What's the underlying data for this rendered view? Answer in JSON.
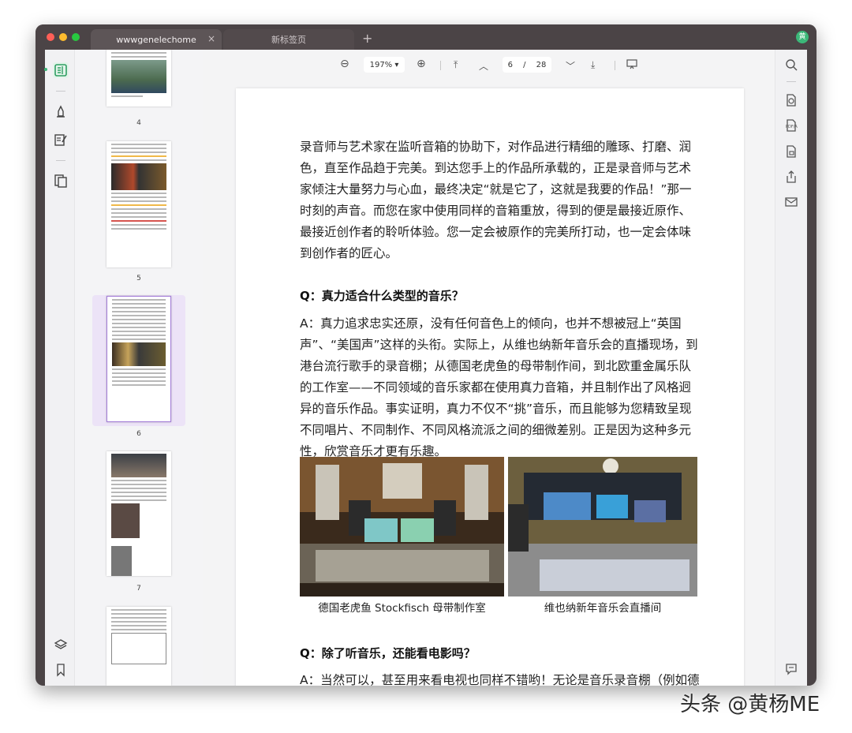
{
  "tabs": [
    {
      "label": "wwwgenelechome",
      "active": true
    },
    {
      "label": "新标签页",
      "active": false
    }
  ],
  "new_tab_glyph": "+",
  "tab_close_glyph": "×",
  "avatar_letter": "黄",
  "toolbar": {
    "zoom_out_glyph": "⊖",
    "zoom": "197%",
    "zoom_dropdown_glyph": "▾",
    "zoom_in_glyph": "⊕",
    "first_page_glyph": "⤒",
    "prev_page_glyph": "︿",
    "current_page": "6",
    "page_separator": "/",
    "total_pages": "28",
    "next_page_glyph": "﹀",
    "last_page_glyph": "⤓"
  },
  "thumbnails": [
    {
      "page_label": "4"
    },
    {
      "page_label": "5"
    },
    {
      "page_label": "6",
      "selected": true
    },
    {
      "page_label": "7"
    }
  ],
  "document": {
    "para1": "录音师与艺术家在监听音箱的协助下，对作品进行精细的雕琢、打磨、润色，直至作品趋于完美。到达您手上的作品所承载的，正是录音师与艺术家倾注大量努力与心血，最终决定“就是它了，这就是我要的作品！”那一时刻的声音。而您在家中使用同样的音箱重放，得到的便是最接近原作、最接近创作者的聆听体验。您一定会被原作的完美所打动，也一定会体味到创作者的匠心。",
    "q1": "Q：真力适合什么类型的音乐？",
    "a1": "A：真力追求忠实还原，没有任何音色上的倾向，也并不想被冠上“英国声”、“美国声”这样的头衔。实际上，从维也纳新年音乐会的直播现场，到港台流行歌手的录音棚；从德国老虎鱼的母带制作间，到北欧重金属乐队的工作室——不同领域的音乐家都在使用真力音箱，并且制作出了风格迥异的音乐作品。事实证明，真力不仅不“挑”音乐，而且能够为您精致呈现不同唱片、不同制作、不同风格流派之间的细微差别。正是因为这种多元性，欣赏音乐才更有乐趣。",
    "caption1": "德国老虎鱼 Stockfisch 母带制作室",
    "caption2": "维也纳新年音乐会直播间",
    "q2": "Q：除了听音乐，还能看电影吗？",
    "a2": "A：当然可以，甚至用来看电视也同样不错哟！无论是音乐录音棚（例如德"
  },
  "left_icons": [
    "reader-icon",
    "highlighter-icon",
    "edit-page-icon",
    "organize-pages-icon",
    "layers-icon",
    "bookmark-icon"
  ],
  "right_icons": [
    "search-icon",
    "convert-icon",
    "pdfa-icon",
    "protect-icon",
    "share-icon",
    "mail-icon",
    "comment-icon"
  ],
  "watermark": "头条 @黄杨ME",
  "colors": {
    "accent": "#3cb879",
    "selection": "#ece3f7",
    "window": "#4b4446"
  }
}
